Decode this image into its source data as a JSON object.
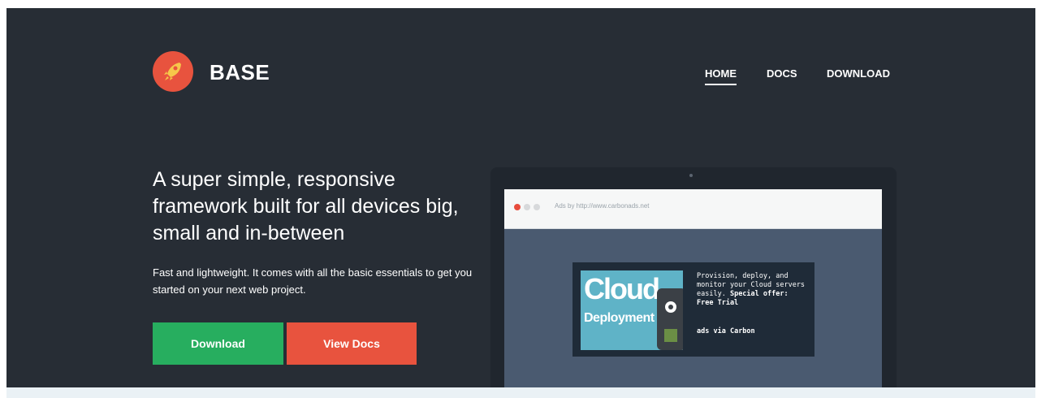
{
  "brand": {
    "name": "BASE",
    "logo_icon": "rocket-icon",
    "logo_color": "#e8533e"
  },
  "nav": {
    "home": "HOME",
    "docs": "DOCS",
    "download": "DOWNLOAD"
  },
  "hero": {
    "headline": "A super simple, responsive framework built for all devices big, small and in-between",
    "subtext": "Fast and lightweight. It comes with all the basic essentials to get you started on your next web project.",
    "buttons": {
      "download": {
        "label": "Download",
        "color": "#27ae5f"
      },
      "view_docs": {
        "label": "View Docs",
        "color": "#e8533e"
      }
    },
    "background": "#272d35"
  },
  "ad_preview": {
    "url": "Ads by http://www.carbonads.net",
    "image_title": "Cloud",
    "image_subtitle": "Deployment",
    "text_main": "Provision, deploy, and monitor your Cloud servers easily.",
    "text_offer": "Special offer: Free Trial",
    "via_prefix": "ads via",
    "via_name": "Carbon"
  }
}
